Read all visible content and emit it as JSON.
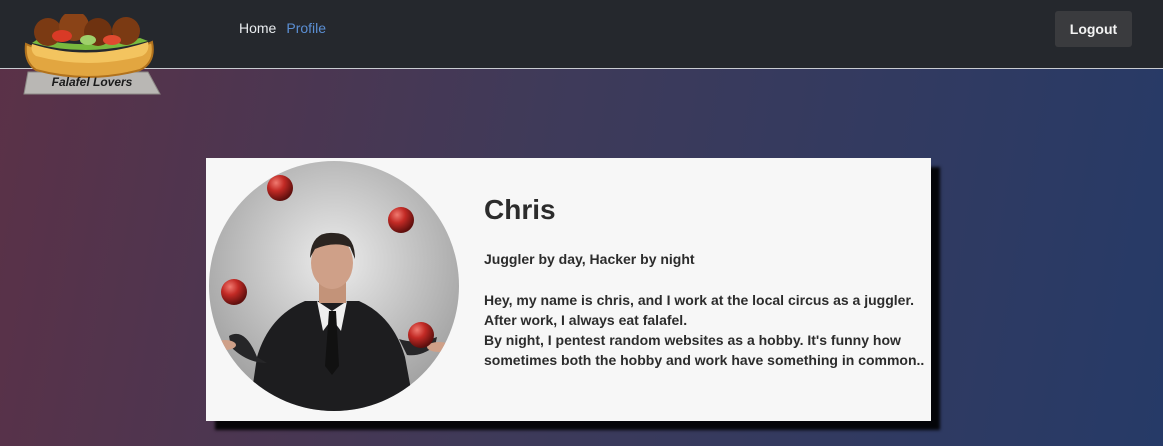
{
  "brand": {
    "logo_text": "Falafel Lovers"
  },
  "nav": {
    "items": [
      {
        "label": "Home",
        "active": false
      },
      {
        "label": "Profile",
        "active": true
      }
    ],
    "logout_label": "Logout"
  },
  "profile": {
    "name": "Chris",
    "tagline": "Juggler by day, Hacker by night",
    "bio_lines": [
      "Hey, my name is chris, and I work at the local circus as a juggler.",
      "After work, I always eat falafel.",
      "By night, I pentest random websites as a hobby. It's funny how",
      "sometimes both the hobby and work have something in common.."
    ]
  },
  "colors": {
    "navbar_bg": "#25282d",
    "active_link": "#5b8fd4",
    "card_bg": "#f7f7f7",
    "logout_bg": "#3a3b3e"
  }
}
